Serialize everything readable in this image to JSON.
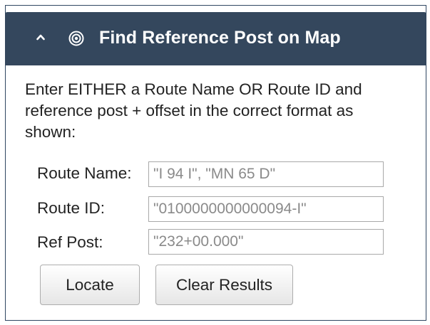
{
  "panel": {
    "title": "Find Reference Post on Map",
    "collapse_icon": "chevron-up-icon",
    "title_icon": "target-icon"
  },
  "instructions": "Enter EITHER a Route Name OR Route ID and reference post + offset in the correct format as shown:",
  "form": {
    "route_name_label": "Route Name:",
    "route_name_placeholder": "\"I 94 I\", \"MN 65 D\"",
    "route_id_label": "Route ID:",
    "route_id_placeholder": "\"0100000000000094-I\"",
    "ref_post_label": "Ref Post:",
    "ref_post_placeholder": "\"232+00.000\""
  },
  "buttons": {
    "locate_label": "Locate",
    "clear_label": "Clear Results"
  },
  "colors": {
    "header_bg": "#34475d",
    "border": "#2f4661"
  }
}
